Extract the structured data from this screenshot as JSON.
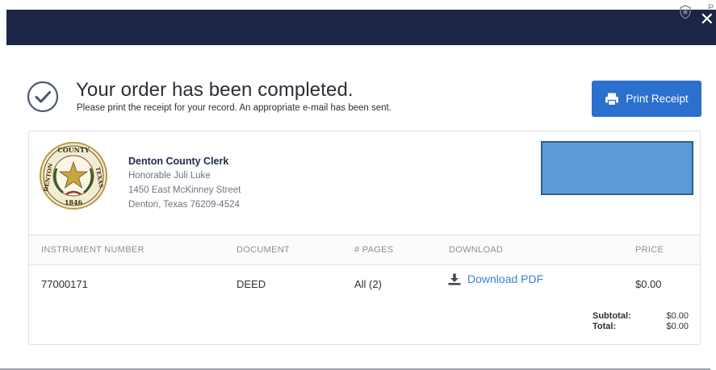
{
  "header": {
    "close_glyph": "✕",
    "pro_text": "Pro"
  },
  "confirmation": {
    "title": "Your order has been completed.",
    "subtitle": "Please print the receipt for your record. An appropriate e-mail has been sent.",
    "print_button_label": "Print Receipt"
  },
  "clerk": {
    "name": "Denton County Clerk",
    "lines": [
      "Honorable Juli Luke",
      "1450 East McKinney Street",
      "Denton, Texas 76209-4524"
    ],
    "seal_text_top": "COUNTY",
    "seal_text_left": "DENTON",
    "seal_text_right": "TEXAS",
    "seal_year": "1846"
  },
  "table": {
    "headers": [
      "INSTRUMENT NUMBER",
      "DOCUMENT",
      "# PAGES",
      "DOWNLOAD",
      "PRICE"
    ],
    "rows": [
      {
        "instrument_number": "77000171",
        "document": "DEED",
        "pages": "All (2)",
        "download_label": "Download PDF",
        "price": "$0.00"
      }
    ]
  },
  "totals": {
    "subtotal_label": "Subtotal:",
    "subtotal_value": "$0.00",
    "total_label": "Total:",
    "total_value": "$0.00"
  },
  "colors": {
    "topbar": "#1c2545",
    "accent": "#2b6fcf",
    "link": "#3a82d3",
    "redaction": "#5b9ad6"
  }
}
